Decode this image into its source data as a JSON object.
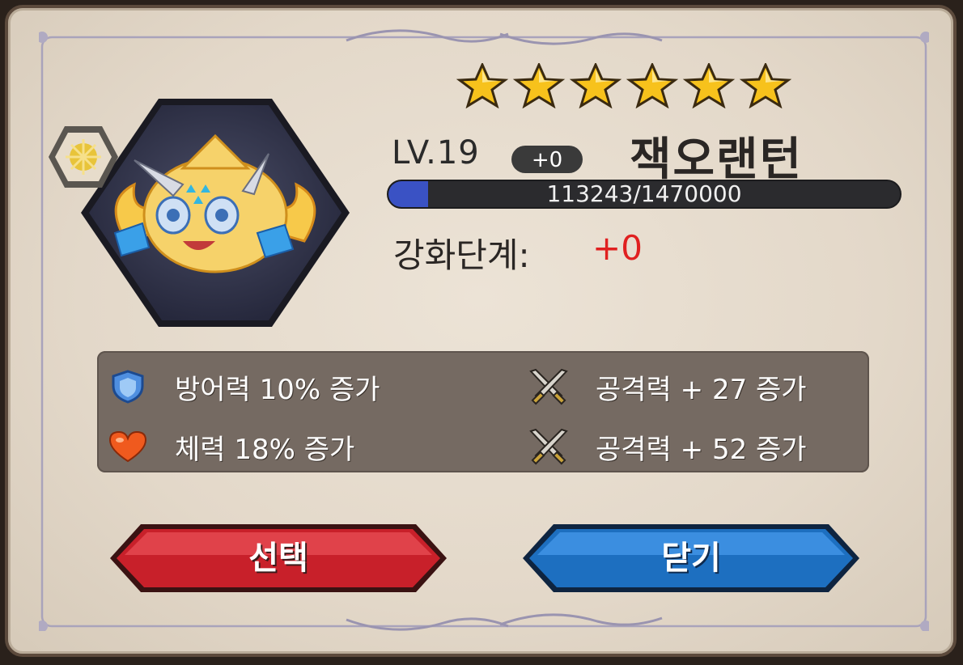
{
  "card": {
    "stars": 6,
    "level_label": "LV.19",
    "level_plus": "+0",
    "name": "잭오랜턴",
    "xp": {
      "current": 113243,
      "max": 1470000,
      "text": "113243/1470000"
    },
    "enhance_label": "강화단계:",
    "enhance_value": "+0"
  },
  "stats": [
    {
      "icon": "shield-icon",
      "text": "방어력 10% 증가"
    },
    {
      "icon": "crossed-swords-icon",
      "text": "공격력 + 27 증가"
    },
    {
      "icon": "heart-icon",
      "text": "체력 18% 증가"
    },
    {
      "icon": "crossed-swords-icon",
      "text": "공격력 + 52 증가"
    }
  ],
  "buttons": {
    "select_label": "선택",
    "close_label": "닫기"
  },
  "colors": {
    "select_button": "#c8202a",
    "close_button": "#1d6fc0",
    "enhance_value": "#e02020",
    "xp_fill": "#3a52c4"
  }
}
